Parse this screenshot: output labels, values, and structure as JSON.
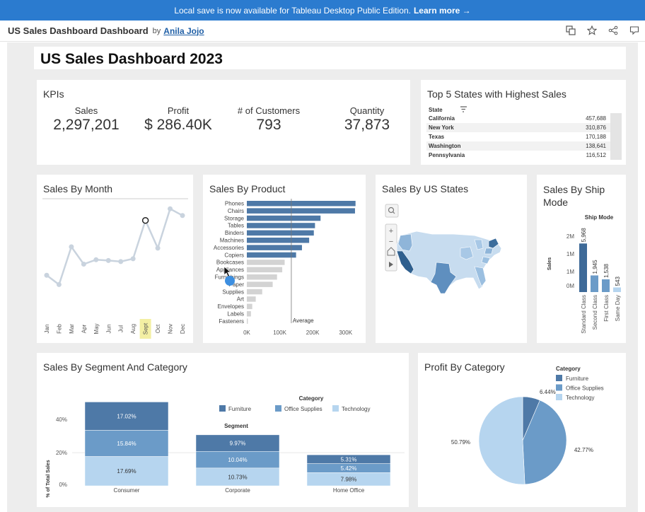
{
  "banner": {
    "text": "Local save is now available for Tableau Desktop Public Edition.",
    "link": "Learn more →"
  },
  "topbar": {
    "viz_title": "US Sales Dashboard Dashboard",
    "by": "by",
    "author": "Anila Jojo",
    "icons": [
      "copy-icon",
      "star-icon",
      "share-icon",
      "comment-icon"
    ]
  },
  "dashboard": {
    "title": "US Sales Dashboard 2023"
  },
  "kpis": {
    "title": "KPIs",
    "items": [
      {
        "label": "Sales",
        "value": "2,297,201"
      },
      {
        "label": "Profit",
        "value": "$ 286.40K"
      },
      {
        "label": "# of Customers",
        "value": "793"
      },
      {
        "label": "Quantity",
        "value": "37,873"
      }
    ]
  },
  "top5": {
    "title": "Top 5 States with Highest Sales",
    "column": "State",
    "rows": [
      {
        "state": "California",
        "value": "457,688"
      },
      {
        "state": "New York",
        "value": "310,876"
      },
      {
        "state": "Texas",
        "value": "170,188"
      },
      {
        "state": "Washington",
        "value": "138,641"
      },
      {
        "state": "Pennsylvania",
        "value": "116,512"
      }
    ]
  },
  "sales_by_month": {
    "title": "Sales By Month",
    "highlight": "Sept"
  },
  "sales_by_product": {
    "title": "Sales By Product",
    "reference_label": "Average"
  },
  "map": {
    "title": "Sales By US States"
  },
  "ship_mode": {
    "title": "Sales By Ship Mode",
    "header": "Ship Mode",
    "ylabel": "Sales"
  },
  "segment": {
    "title": "Sales By Segment And Category",
    "legend_title": "Category",
    "column_header": "Segment",
    "ylabel": "% of Total Sales"
  },
  "profit": {
    "title": "Profit By Category",
    "legend_title": "Category"
  },
  "colors": {
    "dark": "#4e79a7",
    "mid": "#6b9bc8",
    "light": "#b6d5ef",
    "grey": "#d3d3d3",
    "accent": "#2b7bcf"
  },
  "chart_data": [
    {
      "type": "line",
      "title": "Sales By Month",
      "categories": [
        "Jan",
        "Feb",
        "Mar",
        "Apr",
        "May",
        "Jun",
        "Jul",
        "Aug",
        "Sept",
        "Oct",
        "Nov",
        "Dec"
      ],
      "values": [
        95000,
        59000,
        205000,
        138000,
        155000,
        152000,
        148000,
        159000,
        307000,
        200000,
        352000,
        326000
      ],
      "ylim": [
        0,
        380000
      ]
    },
    {
      "type": "bar",
      "title": "Sales By Product",
      "categories": [
        "Phones",
        "Chairs",
        "Storage",
        "Tables",
        "Binders",
        "Machines",
        "Accessories",
        "Copiers",
        "Bookcases",
        "Appliances",
        "Furnishings",
        "Paper",
        "Supplies",
        "Art",
        "Envelopes",
        "Labels",
        "Fasteners"
      ],
      "values": [
        330007,
        328449,
        223844,
        206966,
        203413,
        189239,
        167380,
        149528,
        114880,
        107532,
        91705,
        78479,
        46674,
        27119,
        16476,
        12486,
        3024
      ],
      "above_average": [
        true,
        true,
        true,
        true,
        true,
        true,
        true,
        true,
        false,
        false,
        false,
        false,
        false,
        false,
        false,
        false,
        false
      ],
      "average": 135130,
      "xticks": [
        "0K",
        "100K",
        "200K",
        "300K"
      ],
      "xlim": [
        0,
        350000
      ]
    },
    {
      "type": "bar",
      "title": "Sales By Ship Mode",
      "categories": [
        "Standard Class",
        "Second Class",
        "First Class",
        "Same Day"
      ],
      "values": [
        1340000,
        459000,
        351000,
        128000
      ],
      "labels": [
        "5,968",
        "1,945",
        "1,538",
        "543"
      ],
      "yticks": [
        "0M",
        "1M",
        "1M",
        "2M"
      ],
      "ylim": [
        0,
        1600000
      ]
    },
    {
      "type": "bar",
      "title": "Sales By Segment And Category",
      "categories": [
        "Consumer",
        "Corporate",
        "Home Office"
      ],
      "series": [
        {
          "name": "Technology",
          "values": [
            17.69,
            10.73,
            7.98
          ]
        },
        {
          "name": "Office Supplies",
          "values": [
            15.84,
            10.04,
            5.42
          ]
        },
        {
          "name": "Furniture",
          "values": [
            17.02,
            9.97,
            5.31
          ]
        }
      ],
      "yticks": [
        "0%",
        "20%",
        "40%"
      ],
      "ylim": [
        0,
        52
      ]
    },
    {
      "type": "pie",
      "title": "Profit By Category",
      "series": [
        {
          "name": "Furniture",
          "value": 6.44
        },
        {
          "name": "Office Supplies",
          "value": 42.77
        },
        {
          "name": "Technology",
          "value": 50.79
        }
      ]
    }
  ]
}
